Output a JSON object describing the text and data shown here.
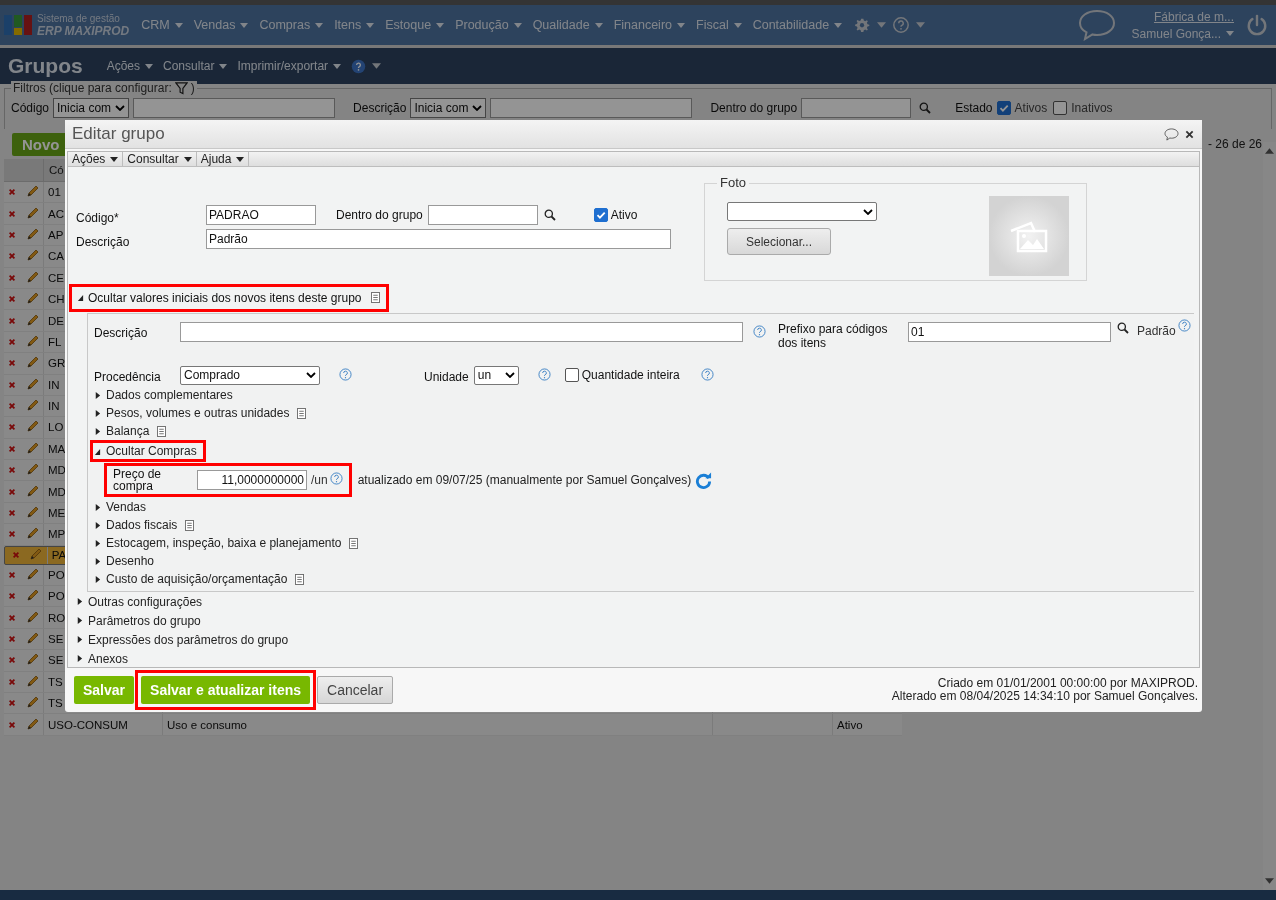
{
  "app": {
    "brand_line1": "Sistema de gestão",
    "brand_line2": "ERP MAXIPROD",
    "menu": [
      "CRM",
      "Vendas",
      "Compras",
      "Itens",
      "Estoque",
      "Produção",
      "Qualidade",
      "Financeiro",
      "Fiscal",
      "Contabilidade"
    ],
    "company": "Fábrica de m...",
    "user": "Samuel Gonça..."
  },
  "page": {
    "title": "Grupos",
    "actions": [
      "Ações",
      "Consultar",
      "Imprimir/exportar"
    ]
  },
  "filters": {
    "legend": "Filtros (clique para configurar:",
    "legend_end": ")",
    "codigo_label": "Código",
    "codigo_mode": "Inicia com",
    "descricao_label": "Descrição",
    "descricao_mode": "Inicia com",
    "group_label": "Dentro do grupo",
    "state_label": "Estado",
    "states": [
      {
        "label": "Ativos",
        "checked": true
      },
      {
        "label": "Inativos",
        "checked": false
      }
    ]
  },
  "toolbar": {
    "new_button": "Novo",
    "count": "- 26 de 26"
  },
  "table": {
    "header": "Có",
    "rows": [
      {
        "code": "01",
        "selected": false
      },
      {
        "code": "AC",
        "selected": false
      },
      {
        "code": "AP",
        "selected": false
      },
      {
        "code": "CA",
        "selected": false
      },
      {
        "code": "CE",
        "selected": false
      },
      {
        "code": "CH",
        "selected": false
      },
      {
        "code": "DE",
        "selected": false
      },
      {
        "code": "FL",
        "selected": false
      },
      {
        "code": "GR",
        "selected": false
      },
      {
        "code": "IN",
        "selected": false
      },
      {
        "code": "IN",
        "selected": false
      },
      {
        "code": "LO",
        "selected": false
      },
      {
        "code": "MA",
        "selected": false
      },
      {
        "code": "MD",
        "selected": false
      },
      {
        "code": "MD",
        "selected": false
      },
      {
        "code": "ME",
        "selected": false
      },
      {
        "code": "MP",
        "selected": false
      },
      {
        "code": "PA",
        "selected": true
      },
      {
        "code": "PO",
        "selected": false
      },
      {
        "code": "PO",
        "selected": false
      },
      {
        "code": "RO",
        "selected": false
      },
      {
        "code": "SE",
        "selected": false
      },
      {
        "code": "SE",
        "selected": false
      },
      {
        "code": "TS",
        "selected": false
      },
      {
        "code": "TS",
        "selected": false
      },
      {
        "code": "USO-CONSUM",
        "description": "Uso e consumo",
        "status": "Ativo",
        "selected": false
      }
    ]
  },
  "dialog": {
    "title": "Editar grupo",
    "menu": [
      "Ações",
      "Consultar",
      "Ajuda"
    ],
    "codigo_label": "Código*",
    "codigo": "PADRAO",
    "group_label": "Dentro do grupo",
    "ativo": {
      "label": "Ativo",
      "checked": true
    },
    "descricao_label": "Descrição",
    "descricao": "Padrão",
    "foto": {
      "legend": "Foto",
      "button": "Selecionar..."
    },
    "section": {
      "label": "Ocultar valores iniciais dos novos itens deste grupo",
      "expanded": true,
      "highlighted": true
    },
    "inner": {
      "descricao_label": "Descrição",
      "prefix_label": "Prefixo para códigos dos itens",
      "prefix": "01",
      "prefix_note": "Padrão",
      "procedencia_label": "Procedência",
      "procedencia": "Comprado",
      "unidade_label": "Unidade",
      "unidade": "un",
      "quantity": {
        "label": "Quantidade inteira",
        "checked": false
      }
    },
    "subsections": [
      {
        "label": "Dados complementares",
        "expanded": false,
        "highlighted": false,
        "note": false
      },
      {
        "label": "Pesos, volumes e outras unidades",
        "expanded": false,
        "highlighted": false,
        "note": true
      },
      {
        "label": "Balança",
        "expanded": false,
        "highlighted": false,
        "note": true
      },
      {
        "label": "Ocultar Compras",
        "expanded": true,
        "highlighted": true,
        "note": false,
        "price": {
          "label": "Preço de compra",
          "value": "11,0000000000",
          "unit": "/un",
          "highlighted": true,
          "updated": "atualizado em 09/07/25 (manualmente por Samuel Gonçalves)"
        }
      },
      {
        "label": "Vendas",
        "expanded": false,
        "highlighted": false,
        "note": false
      },
      {
        "label": "Dados fiscais",
        "expanded": false,
        "highlighted": false,
        "note": true
      },
      {
        "label": "Estocagem, inspeção, baixa e planejamento",
        "expanded": false,
        "highlighted": false,
        "note": true
      },
      {
        "label": "Desenho",
        "expanded": false,
        "highlighted": false,
        "note": false
      },
      {
        "label": "Custo de aquisição/orçamentação",
        "expanded": false,
        "highlighted": false,
        "note": true
      }
    ],
    "outer_sections": [
      {
        "label": "Outras configurações",
        "expanded": false
      },
      {
        "label": "Parâmetros do grupo",
        "expanded": false
      },
      {
        "label": "Expressões dos parâmetros do grupo",
        "expanded": false
      },
      {
        "label": "Anexos",
        "expanded": false
      }
    ],
    "buttons": [
      {
        "label": "Salvar",
        "kind": "primary",
        "highlighted": false
      },
      {
        "label": "Salvar e atualizar itens",
        "kind": "primary",
        "highlighted": true
      },
      {
        "label": "Cancelar",
        "kind": "secondary",
        "highlighted": false
      }
    ],
    "audit": [
      "Criado em 01/01/2001 00:00:00 por MAXIPROD.",
      "Alterado em 08/04/2025 14:34:10 por Samuel Gonçalves."
    ]
  }
}
